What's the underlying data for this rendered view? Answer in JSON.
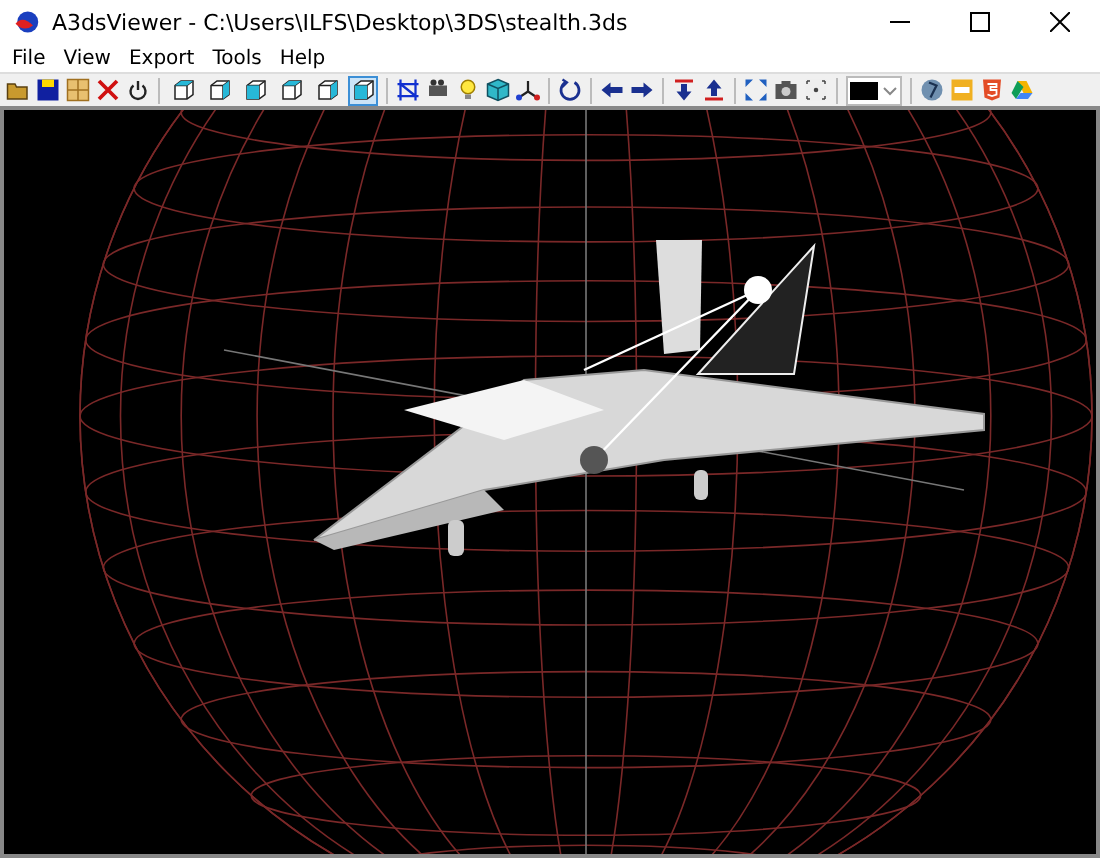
{
  "window": {
    "title": "A3dsViewer - C:\\Users\\ILFS\\Desktop\\3DS\\stealth.3ds"
  },
  "menu": [
    "File",
    "View",
    "Export",
    "Tools",
    "Help"
  ],
  "view_buttons": [
    {
      "selected": false
    },
    {
      "selected": false
    },
    {
      "selected": false
    },
    {
      "selected": false
    },
    {
      "selected": false
    },
    {
      "selected": true
    }
  ]
}
